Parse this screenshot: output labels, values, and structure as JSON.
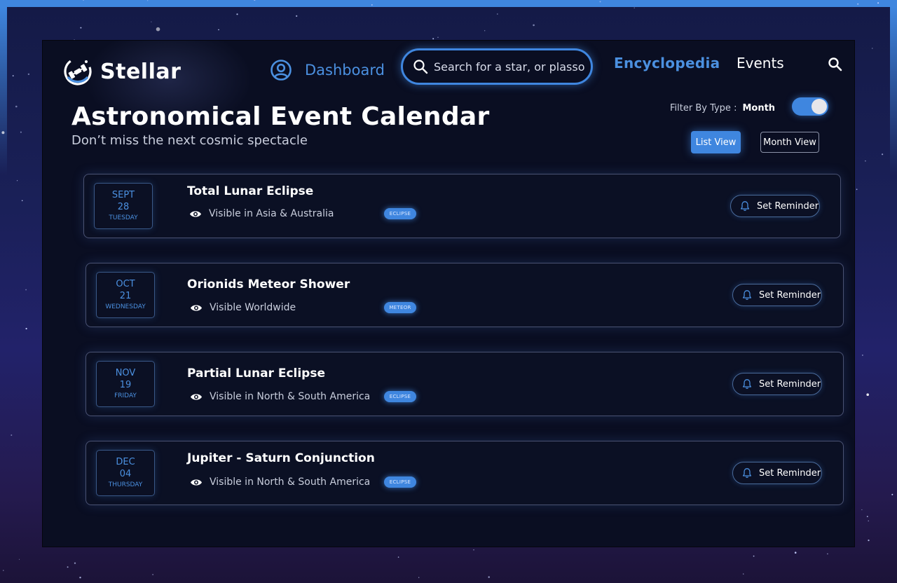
{
  "app": {
    "name": "Stellar"
  },
  "nav": {
    "dashboard_label": "Dashboard",
    "search_placeholder": "Search for a star, or plasso",
    "encyclopedia_label": "Encyclopedia",
    "events_label": "Events"
  },
  "page": {
    "title": "Astronomical Event Calendar",
    "subtitle": "Don’t miss the next cosmic spectacle"
  },
  "filter": {
    "label": "Filter By Type :",
    "value": "Month",
    "toggle_on": true
  },
  "views": {
    "list_label": "List View",
    "month_label": "Month View",
    "active": "List View"
  },
  "events": [
    {
      "month": "SEPT",
      "day": "28",
      "weekday": "TUESDAY",
      "title": "Total Lunar Eclipse",
      "visibility": "Visible in Asia & Australia",
      "type": "ECLIPSE",
      "action": "Set Reminder"
    },
    {
      "month": "OCT",
      "day": "21",
      "weekday": "WEDNESDAY",
      "title": "Orionids Meteor Shower",
      "visibility": "Visible Worldwide",
      "type": "METEOR",
      "action": "Set Reminder"
    },
    {
      "month": "NOV",
      "day": "19",
      "weekday": "FRIDAY",
      "title": "Partial Lunar Eclipse",
      "visibility": "Visible in North & South America",
      "type": "ECLIPSE",
      "action": "Set Reminder"
    },
    {
      "month": "DEC",
      "day": "04",
      "weekday": "THURSDAY",
      "title": "Jupiter - Saturn Conjunction",
      "visibility": "Visible in North & South America",
      "type": "ECLIPSE",
      "action": "Set Reminder"
    }
  ],
  "icons": {
    "logo": "satellite-orbit-icon",
    "dashboard": "user-circle-icon",
    "search": "search-icon",
    "visibility": "eye-icon",
    "reminder": "bell-icon"
  },
  "colors": {
    "accent": "#3f86df",
    "accent_text": "#4b90e0",
    "panel_bg": "#0a0e22",
    "card_border": "#4a5272"
  }
}
